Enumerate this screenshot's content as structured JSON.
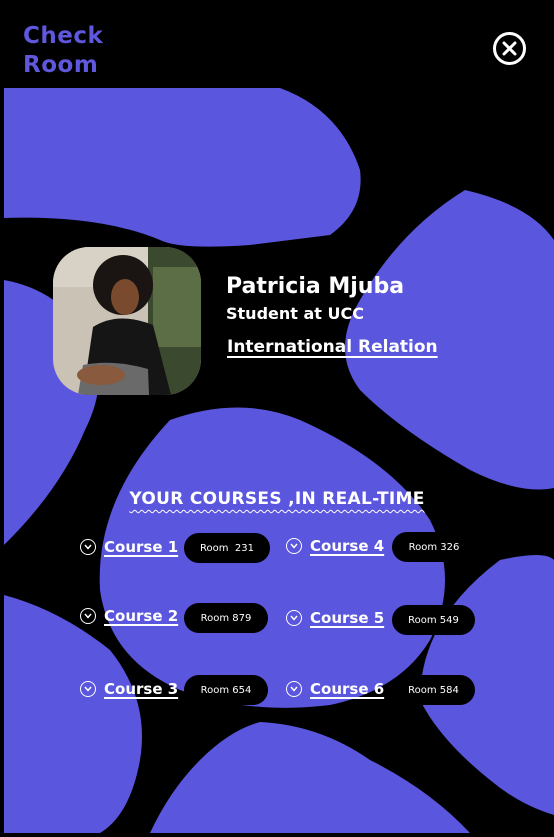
{
  "app": {
    "logo": "Check\nRoom"
  },
  "profile": {
    "name": "Patricia Mjuba",
    "role": "Student at UCC",
    "program": "International Relation"
  },
  "courses": {
    "title": "YOUR COURSES ,IN REAL-TIME",
    "items": [
      {
        "label": "Course 1",
        "room": "Room  231"
      },
      {
        "label": "Course 2",
        "room": "Room 879"
      },
      {
        "label": "Course 3",
        "room": "Room 654"
      },
      {
        "label": "Course 4",
        "room": "Room 326"
      },
      {
        "label": "Course 5",
        "room": "Room 549"
      },
      {
        "label": "Course 6",
        "room": "Room 584"
      }
    ]
  },
  "icons": {
    "close": "close-icon",
    "chevron": "chevron-down-icon"
  },
  "colors": {
    "background": "#000000",
    "accent": "#5f57dc",
    "text": "#ffffff"
  }
}
